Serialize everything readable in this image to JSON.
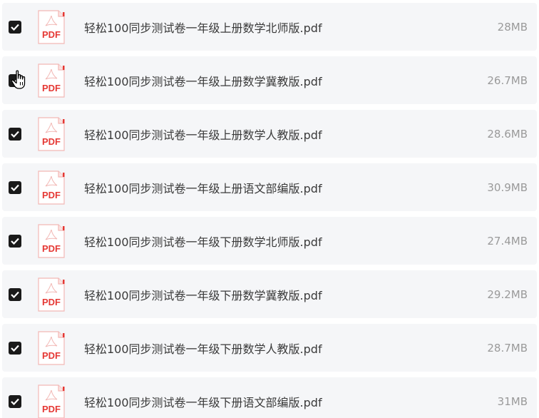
{
  "files": [
    {
      "name": "轻松100同步测试卷一年级上册数学北师版.pdf",
      "size": "28MB",
      "checked": true,
      "icon": "pdf-file-icon"
    },
    {
      "name": "轻松100同步测试卷一年级上册数学冀教版.pdf",
      "size": "26.7MB",
      "checked": true,
      "icon": "pdf-file-icon"
    },
    {
      "name": "轻松100同步测试卷一年级上册数学人教版.pdf",
      "size": "28.6MB",
      "checked": true,
      "icon": "pdf-file-icon"
    },
    {
      "name": "轻松100同步测试卷一年级上册语文部编版.pdf",
      "size": "30.9MB",
      "checked": true,
      "icon": "pdf-file-icon"
    },
    {
      "name": "轻松100同步测试卷一年级下册数学北师版.pdf",
      "size": "27.4MB",
      "checked": true,
      "icon": "pdf-file-icon"
    },
    {
      "name": "轻松100同步测试卷一年级下册数学冀教版.pdf",
      "size": "29.2MB",
      "checked": true,
      "icon": "pdf-file-icon"
    },
    {
      "name": "轻松100同步测试卷一年级下册数学人教版.pdf",
      "size": "28.7MB",
      "checked": true,
      "icon": "pdf-file-icon"
    },
    {
      "name": "轻松100同步测试卷一年级下册语文部编版.pdf",
      "size": "31MB",
      "checked": true,
      "icon": "pdf-file-icon"
    }
  ],
  "pdf_label": "PDF",
  "colors": {
    "row_background": "#f5f6f8",
    "checkbox": "#1a1a1a",
    "pdf_red": "#e53935",
    "name_text": "#3a3a3a",
    "size_text": "#9a9a9a"
  },
  "cursor_icon": "hand-pointer-icon"
}
